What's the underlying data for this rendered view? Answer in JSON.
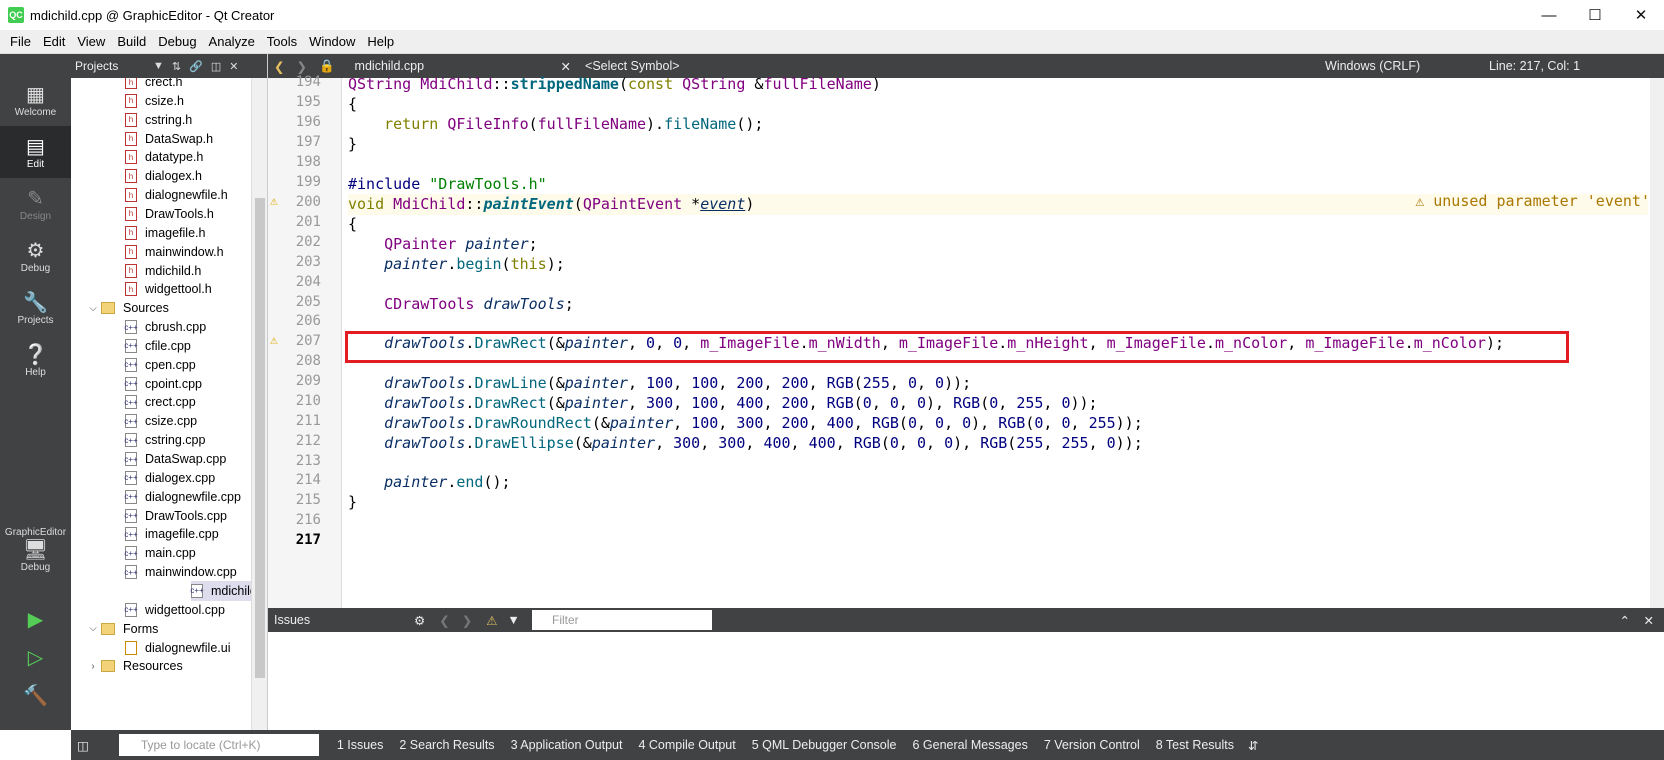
{
  "window": {
    "title": "mdichild.cpp @ GraphicEditor - Qt Creator",
    "app_icon": "QC"
  },
  "menu": [
    "File",
    "Edit",
    "View",
    "Build",
    "Debug",
    "Analyze",
    "Tools",
    "Window",
    "Help"
  ],
  "modes": {
    "welcome": "Welcome",
    "edit": "Edit",
    "design": "Design",
    "debug": "Debug",
    "projects": "Projects",
    "help": "Help",
    "target": "GraphicEditor",
    "target_mode": "Debug"
  },
  "project_pane": {
    "selector": "Projects"
  },
  "tree": {
    "headers": [
      "crect.h",
      "csize.h",
      "cstring.h",
      "DataSwap.h",
      "datatype.h",
      "dialogex.h",
      "dialognewfile.h",
      "DrawTools.h",
      "imagefile.h",
      "mainwindow.h",
      "mdichild.h",
      "widgettool.h"
    ],
    "sources_label": "Sources",
    "sources": [
      "cbrush.cpp",
      "cfile.cpp",
      "cpen.cpp",
      "cpoint.cpp",
      "crect.cpp",
      "csize.cpp",
      "cstring.cpp",
      "DataSwap.cpp",
      "dialogex.cpp",
      "dialognewfile.cpp",
      "DrawTools.cpp",
      "imagefile.cpp",
      "main.cpp",
      "mainwindow.cpp",
      "mdichild.cpp",
      "widgettool.cpp"
    ],
    "forms_label": "Forms",
    "forms": [
      "dialognewfile.ui"
    ],
    "resources_label": "Resources"
  },
  "editor_toolbar": {
    "file": "mdichild.cpp",
    "symbol": "<Select Symbol>",
    "encoding": "Windows (CRLF)",
    "position": "Line: 217, Col: 1"
  },
  "code": {
    "line_numbers": [
      "194",
      "195",
      "196",
      "197",
      "198",
      "199",
      "200",
      "201",
      "202",
      "203",
      "204",
      "205",
      "206",
      "207",
      "208",
      "209",
      "210",
      "211",
      "212",
      "213",
      "214",
      "215",
      "216",
      "217"
    ],
    "warning": "unused parameter 'event'"
  },
  "issues": {
    "title": "Issues",
    "filter_placeholder": "Filter"
  },
  "status": {
    "locate_placeholder": "Type to locate (Ctrl+K)",
    "tabs": [
      "1  Issues",
      "2  Search Results",
      "3  Application Output",
      "4  Compile Output",
      "5  QML Debugger Console",
      "6  General Messages",
      "7  Version Control",
      "8  Test Results"
    ]
  }
}
